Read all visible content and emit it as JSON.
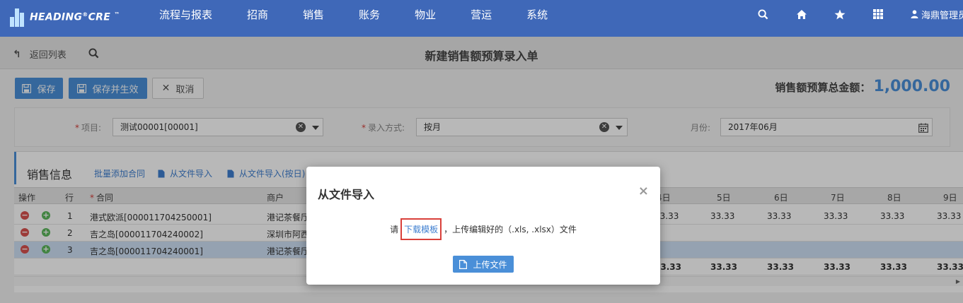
{
  "header": {
    "logo_text": "HEADING",
    "logo_reg": "®",
    "logo_text2": "CRE",
    "logo_tm": "™",
    "nav": [
      "流程与报表",
      "招商",
      "销售",
      "账务",
      "物业",
      "营运",
      "系统"
    ],
    "user_name": "海鼎管理员"
  },
  "subbar": {
    "back_label": "返回列表",
    "page_title": "新建销售额预算录入单"
  },
  "actions": {
    "save": "保存",
    "save_effective": "保存并生效",
    "cancel": "取消",
    "total_label": "销售额预算总金额：",
    "total_value": "1,000.00"
  },
  "form": {
    "project_label": "项目:",
    "project_value": "测试00001[00001]",
    "entry_label": "录入方式:",
    "entry_value": "按月",
    "month_label": "月份:",
    "month_value": "2017年06月"
  },
  "section": {
    "title": "销售信息",
    "links": [
      "批量添加合同",
      "从文件导入",
      "从文件导入(按日)"
    ]
  },
  "grid": {
    "headers": {
      "op": "操作",
      "row": "行",
      "contract": "合同",
      "tenant": "商户",
      "days": [
        "4日",
        "5日",
        "6日",
        "7日",
        "8日",
        "9日"
      ]
    },
    "rows": [
      {
        "no": "1",
        "contract": "港式欧派[000011704250001]",
        "tenant": "港记茶餐厅",
        "vals": [
          "33.33",
          "33.33",
          "33.33",
          "33.33",
          "33.33",
          "33.33"
        ]
      },
      {
        "no": "2",
        "contract": "吉之岛[000011704240002]",
        "tenant": "深圳市阿西",
        "vals": []
      },
      {
        "no": "3",
        "contract": "吉之岛[000011704240001]",
        "tenant": "港记茶餐厅",
        "vals": []
      }
    ],
    "sum_vals": [
      "33.33",
      "33.33",
      "33.33",
      "33.33",
      "33.33",
      "33.33"
    ]
  },
  "modal": {
    "title": "从文件导入",
    "close": "×",
    "msg_prefix": "请",
    "download_link": "下载模板",
    "msg_suffix": "，上传编辑好的（.xls, .xlsx）文件",
    "upload_button": "上传文件"
  }
}
